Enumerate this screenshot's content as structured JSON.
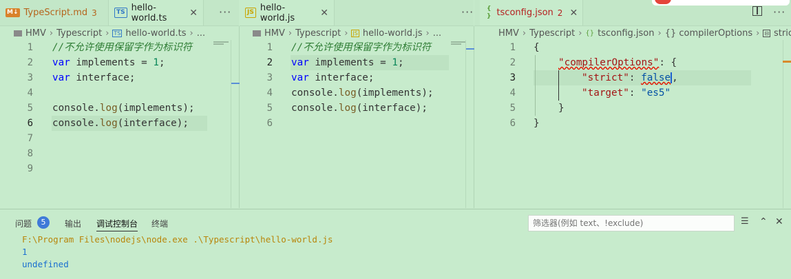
{
  "tabs": {
    "pane1": [
      {
        "label": "TypeScript.md",
        "badge": "3",
        "icon": "markdown-icon"
      },
      {
        "label": "hello-world.ts",
        "icon": "ts-file-icon"
      }
    ],
    "pane2": [
      {
        "label": "hello-world.js",
        "icon": "js-file-icon"
      }
    ],
    "pane3": [
      {
        "label": "tsconfig.json",
        "badge": "2",
        "icon": "json-file-icon"
      }
    ],
    "more": "···"
  },
  "breadcrumbs": {
    "pane1": [
      "HMV",
      "Typescript",
      "hello-world.ts",
      "..."
    ],
    "pane2": [
      "HMV",
      "Typescript",
      "hello-world.js",
      "..."
    ],
    "pane3": [
      "HMV",
      "Typescript",
      "tsconfig.json",
      "{} compilerOptions",
      "strict"
    ]
  },
  "editor_ts": {
    "line_numbers": [
      "1",
      "2",
      "3",
      "4",
      "5",
      "6",
      "7",
      "8",
      "9"
    ],
    "current_line": 6,
    "lines": {
      "l1": "//不允许使用保留字作为标识符",
      "l2_kw": "var",
      "l2_id": " implements ",
      "l2_op": "= ",
      "l2_num": "1",
      "l2_end": ";",
      "l3_kw": "var",
      "l3_id": " interface;",
      "l5_a": "console.",
      "l5_fn": "log",
      "l5_b": "(implements);",
      "l6_a": "console.",
      "l6_fn": "log",
      "l6_b": "(interface);"
    }
  },
  "editor_js": {
    "line_numbers": [
      "1",
      "2",
      "3",
      "4",
      "5",
      "6"
    ],
    "current_line": 2,
    "lines": {
      "l1": "//不允许使用保留字作为标识符",
      "l2_kw": "var",
      "l2_id": " implements ",
      "l2_op": "= ",
      "l2_num": "1",
      "l2_end": ";",
      "l3_kw": "var",
      "l3_id": " interface;",
      "l4_a": "console.",
      "l4_fn": "log",
      "l4_b": "(implements);",
      "l5_a": "console.",
      "l5_fn": "log",
      "l5_b": "(interface);"
    }
  },
  "editor_json": {
    "line_numbers": [
      "1",
      "2",
      "3",
      "4",
      "5",
      "6"
    ],
    "current_line": 3,
    "lines": {
      "l1": "{",
      "l2_key": "\"compilerOptions\"",
      "l2_rest": ": {",
      "l3_key": "\"strict\"",
      "l3_colon": ": ",
      "l3_val": "false",
      "l3_end": ",",
      "l4_key": "\"target\"",
      "l4_colon": ": ",
      "l4_val": "\"es5\"",
      "l5": "}",
      "l6": "}"
    }
  },
  "panel": {
    "tabs": {
      "problems": "问题",
      "output": "输出",
      "debug_console": "调试控制台",
      "terminal": "终端"
    },
    "problems_count": "5",
    "filter_placeholder": "筛选器(例如 text、!exclude)",
    "output_lines": [
      "F:\\Program Files\\nodejs\\node.exe .\\Typescript\\hello-world.js",
      "1",
      "undefined"
    ]
  },
  "colors": {
    "background": "#c7ebcc",
    "keyword": "#0000ff",
    "comment": "#2f7d35",
    "string": "#a31515",
    "number": "#098658",
    "badge": "#3f7ad8"
  }
}
